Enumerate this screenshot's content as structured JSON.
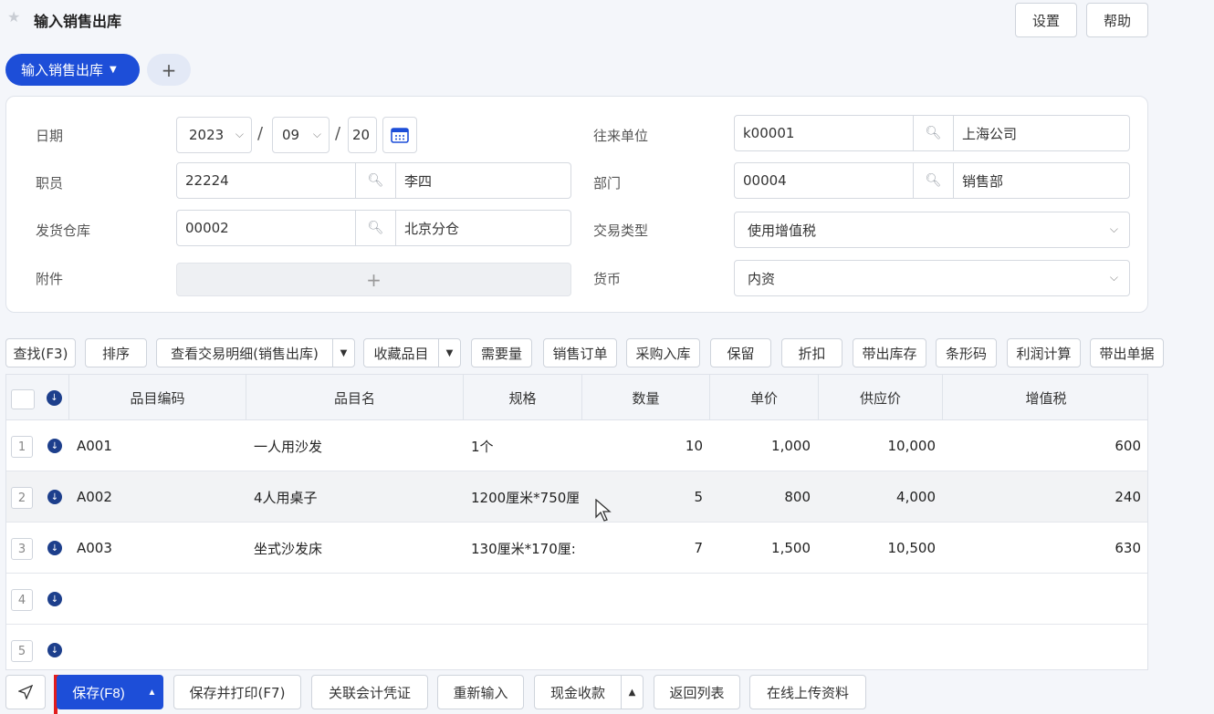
{
  "page": {
    "title": "输入销售出库"
  },
  "top_buttons": {
    "settings": "设置",
    "help": "帮助"
  },
  "tabs": {
    "active": "输入销售出库",
    "add": "+"
  },
  "form": {
    "date": {
      "label": "日期",
      "year": "2023",
      "month": "09",
      "day": "20",
      "sep": "/"
    },
    "partner": {
      "label": "往来单位",
      "code": "k00001",
      "name": "上海公司"
    },
    "employee": {
      "label": "职员",
      "code": "22224",
      "name": "李四"
    },
    "department": {
      "label": "部门",
      "code": "00004",
      "name": "销售部"
    },
    "warehouse": {
      "label": "发货仓库",
      "code": "00002",
      "name": "北京分仓"
    },
    "trade_type": {
      "label": "交易类型",
      "value": "使用增值税"
    },
    "attachment": {
      "label": "附件",
      "add": "+"
    },
    "currency": {
      "label": "货币",
      "value": "内资"
    }
  },
  "toolbar": {
    "find": "查找(F3)",
    "sort": "排序",
    "view_detail": "查看交易明细(销售出库)",
    "favorites": "收藏品目",
    "demand": "需要量",
    "sales_order": "销售订单",
    "purchase_in": "采购入库",
    "reserve": "保留",
    "discount": "折扣",
    "bring_stock": "带出库存",
    "barcode": "条形码",
    "profit": "利润计算",
    "bring_docs": "带出单据"
  },
  "grid": {
    "columns": [
      "品目编码",
      "品目名",
      "规格",
      "数量",
      "单价",
      "供应价",
      "增值税"
    ],
    "rows": [
      {
        "no": "1",
        "code": "A001",
        "name": "一人用沙发",
        "spec": "1个",
        "qty": "10",
        "price": "1,000",
        "supply": "10,000",
        "vat": "600"
      },
      {
        "no": "2",
        "code": "A002",
        "name": "4人用桌子",
        "spec": "1200厘米*750厘",
        "qty": "5",
        "price": "800",
        "supply": "4,000",
        "vat": "240"
      },
      {
        "no": "3",
        "code": "A003",
        "name": "坐式沙发床",
        "spec": "130厘米*170厘:",
        "qty": "7",
        "price": "1,500",
        "supply": "10,500",
        "vat": "630"
      },
      {
        "no": "4",
        "code": "",
        "name": "",
        "spec": "",
        "qty": "",
        "price": "",
        "supply": "",
        "vat": ""
      },
      {
        "no": "5",
        "code": "",
        "name": "",
        "spec": "",
        "qty": "",
        "price": "",
        "supply": "",
        "vat": ""
      }
    ]
  },
  "bottom": {
    "save": "保存(F8)",
    "save_print": "保存并打印(F7)",
    "link_voucher": "关联会计凭证",
    "reenter": "重新输入",
    "cash_receipt": "现金收款",
    "back_list": "返回列表",
    "upload": "在线上传资料"
  },
  "colors": {
    "primary": "#1d4ed8",
    "icon_dark": "#1d3f8c",
    "highlight": "#e11d1d"
  }
}
